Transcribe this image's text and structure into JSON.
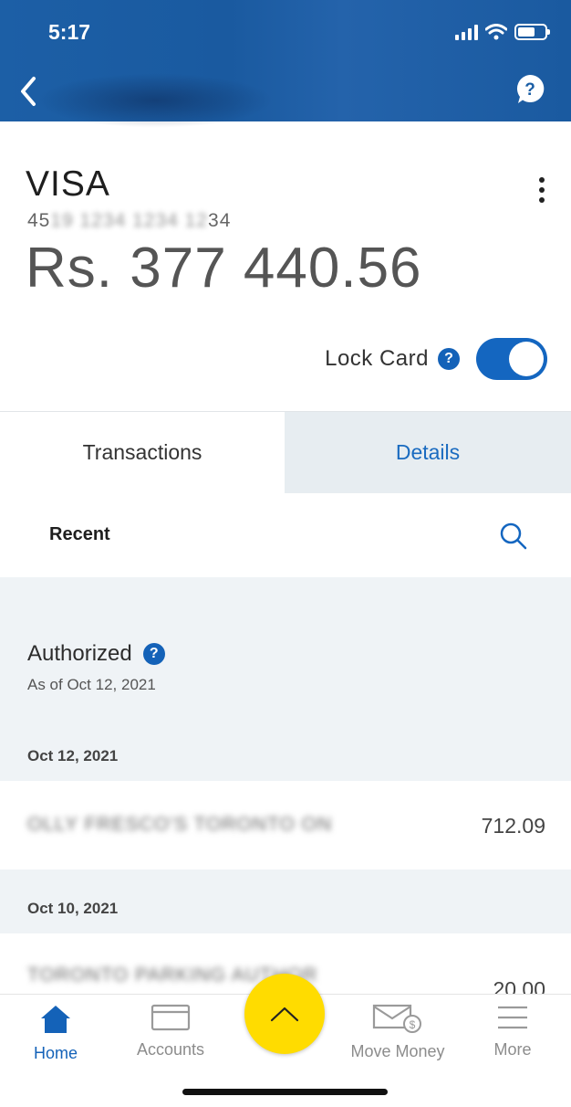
{
  "status_bar": {
    "time": "5:17"
  },
  "card": {
    "name": "VISA",
    "number_prefix": "45",
    "number_hidden": "19 1234 1234 12",
    "number_suffix": "34",
    "balance": "Rs. 377 440.56",
    "lock_label": "Lock Card",
    "lock_on": true
  },
  "tabs": [
    {
      "label": "Transactions",
      "active": true
    },
    {
      "label": "Details",
      "active": false
    }
  ],
  "recent_label": "Recent",
  "authorized": {
    "title": "Authorized",
    "as_of": "As of Oct 12, 2021"
  },
  "transactions": [
    {
      "date": "Oct 12, 2021",
      "description": "OLLY FRESCO'S TORONTO ON",
      "amount": "712.09"
    },
    {
      "date": "Oct 10, 2021",
      "description": "TORONTO PARKING AUTHOR",
      "amount": "20.00"
    }
  ],
  "bottom_nav": [
    {
      "label": "Home",
      "icon": "home-icon",
      "active": true
    },
    {
      "label": "Accounts",
      "icon": "card-icon",
      "active": false
    },
    {
      "label": "Move Money",
      "icon": "envelope-dollar-icon",
      "active": false
    },
    {
      "label": "More",
      "icon": "menu-icon",
      "active": false
    }
  ],
  "colors": {
    "brand_blue": "#1462b8",
    "fab_yellow": "#ffdc00",
    "grey_bg": "#eff3f6"
  }
}
